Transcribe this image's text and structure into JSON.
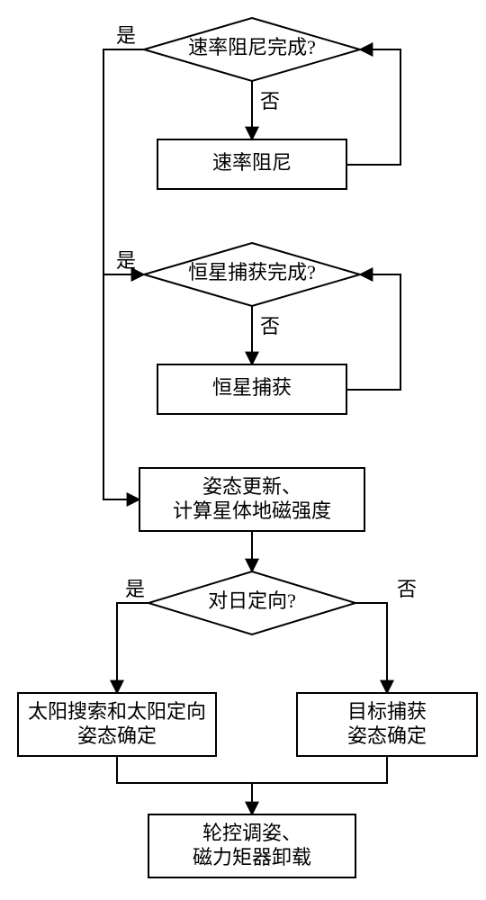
{
  "decisions": {
    "d1": {
      "label": "速率阻尼完成?",
      "yes": "是",
      "no": "否"
    },
    "d2": {
      "label": "恒星捕获完成?",
      "yes": "是",
      "no": "否"
    },
    "d3": {
      "label": "对日定向?",
      "yes": "是",
      "no": "否"
    }
  },
  "processes": {
    "p1": {
      "label": "速率阻尼"
    },
    "p2": {
      "label": "恒星捕获"
    },
    "p3": {
      "line1": "姿态更新、",
      "line2": "计算星体地磁强度"
    },
    "p4": {
      "line1": "太阳搜索和太阳定向",
      "line2": "姿态确定"
    },
    "p5": {
      "line1": "目标捕获",
      "line2": "姿态确定"
    },
    "p6": {
      "line1": "轮控调姿、",
      "line2": "磁力矩器卸载"
    }
  },
  "chart_data": {
    "type": "flowchart",
    "nodes": [
      {
        "id": "d1",
        "kind": "decision",
        "text": "速率阻尼完成?"
      },
      {
        "id": "p1",
        "kind": "process",
        "text": "速率阻尼"
      },
      {
        "id": "d2",
        "kind": "decision",
        "text": "恒星捕获完成?"
      },
      {
        "id": "p2",
        "kind": "process",
        "text": "恒星捕获"
      },
      {
        "id": "p3",
        "kind": "process",
        "text": "姿态更新、计算星体地磁强度"
      },
      {
        "id": "d3",
        "kind": "decision",
        "text": "对日定向?"
      },
      {
        "id": "p4",
        "kind": "process",
        "text": "太阳搜索和太阳定向 姿态确定"
      },
      {
        "id": "p5",
        "kind": "process",
        "text": "目标捕获 姿态确定"
      },
      {
        "id": "p6",
        "kind": "process",
        "text": "轮控调姿、磁力矩器卸载"
      }
    ],
    "edges": [
      {
        "from": "d1",
        "to": "p1",
        "label": "否"
      },
      {
        "from": "p1",
        "to": "d1",
        "label": ""
      },
      {
        "from": "d1",
        "to": "d2",
        "label": "是"
      },
      {
        "from": "d2",
        "to": "p2",
        "label": "否"
      },
      {
        "from": "p2",
        "to": "d2",
        "label": ""
      },
      {
        "from": "d2",
        "to": "p3",
        "label": "是"
      },
      {
        "from": "p3",
        "to": "d3",
        "label": ""
      },
      {
        "from": "d3",
        "to": "p4",
        "label": "是"
      },
      {
        "from": "d3",
        "to": "p5",
        "label": "否"
      },
      {
        "from": "p4",
        "to": "p6",
        "label": ""
      },
      {
        "from": "p5",
        "to": "p6",
        "label": ""
      }
    ]
  }
}
